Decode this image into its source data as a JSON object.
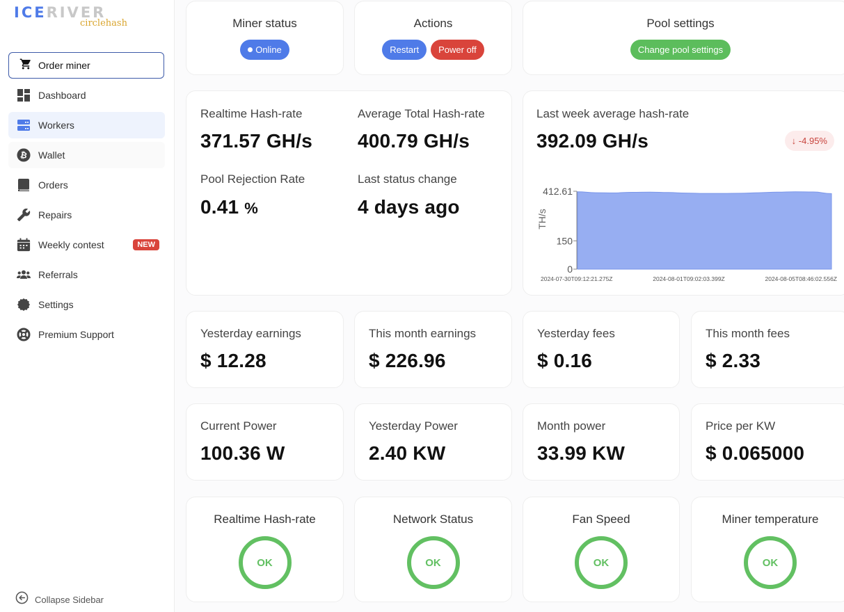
{
  "brand": {
    "name_part1": "ICE",
    "name_part2": "RIVER",
    "sub": "circlehash"
  },
  "sidebar": {
    "order_button": "Order miner",
    "items": [
      {
        "label": "Dashboard",
        "icon": "dashboard-icon"
      },
      {
        "label": "Workers",
        "icon": "server-icon",
        "active": true
      },
      {
        "label": "Wallet",
        "icon": "bitcoin-icon"
      },
      {
        "label": "Orders",
        "icon": "book-icon"
      },
      {
        "label": "Repairs",
        "icon": "wrench-icon"
      },
      {
        "label": "Weekly contest",
        "icon": "calendar-icon",
        "badge": "NEW"
      },
      {
        "label": "Referrals",
        "icon": "users-icon"
      },
      {
        "label": "Settings",
        "icon": "gear-icon"
      },
      {
        "label": "Premium Support",
        "icon": "lifebuoy-icon"
      }
    ],
    "collapse_label": "Collapse Sidebar"
  },
  "status_card": {
    "title": "Miner status",
    "status": "Online"
  },
  "actions_card": {
    "title": "Actions",
    "restart": "Restart",
    "power_off": "Power off"
  },
  "pool_card": {
    "title": "Pool settings",
    "button": "Change pool settings"
  },
  "hashrate_card": {
    "realtime_label": "Realtime Hash-rate",
    "realtime_value": "371.57 GH/s",
    "average_label": "Average Total Hash-rate",
    "average_value": "400.79 GH/s",
    "rejection_label": "Pool Rejection Rate",
    "rejection_value": "0.41",
    "rejection_unit": "%",
    "status_change_label": "Last status change",
    "status_change_value": "4 days ago"
  },
  "week_card": {
    "title": "Last week average hash-rate",
    "value": "392.09 GH/s",
    "trend": "-4.95%",
    "trend_icon": "arrow-down-icon"
  },
  "chart_data": {
    "type": "area",
    "title": "",
    "xlabel": "",
    "ylabel": "TH/s",
    "ylim": [
      0,
      412.61
    ],
    "y_ticks": [
      0,
      150,
      412.61
    ],
    "y_tick_labels": [
      "0",
      "150",
      "412.61"
    ],
    "x_tick_labels": [
      "2024-07-30T09:12:21.275Z",
      "2024-08-01T09:02:03.399Z",
      "2024-08-05T08:46:02.556Z"
    ],
    "grid": false,
    "color": "#97aef2",
    "series": [
      {
        "name": "hash-rate",
        "values": [
          410,
          405,
          404,
          407,
          408,
          406,
          403,
          401,
          401,
          402,
          405,
          408,
          410,
          409,
          400
        ]
      }
    ]
  },
  "earnings": [
    {
      "label": "Yesterday earnings",
      "value": "$ 12.28"
    },
    {
      "label": "This month earnings",
      "value": "$ 226.96"
    },
    {
      "label": "Yesterday fees",
      "value": "$ 0.16"
    },
    {
      "label": "This month fees",
      "value": "$ 2.33"
    }
  ],
  "power": [
    {
      "label": "Current Power",
      "value": "100.36 W"
    },
    {
      "label": "Yesterday Power",
      "value": "2.40 KW"
    },
    {
      "label": "Month power",
      "value": "33.99 KW"
    },
    {
      "label": "Price per KW",
      "value": "$ 0.065000"
    }
  ],
  "health": [
    {
      "label": "Realtime Hash-rate",
      "status": "OK"
    },
    {
      "label": "Network Status",
      "status": "OK"
    },
    {
      "label": "Fan Speed",
      "status": "OK"
    },
    {
      "label": "Miner temperature",
      "status": "OK"
    }
  ],
  "colors": {
    "accent": "#4f7be8",
    "danger": "#d9443b",
    "success": "#5cbd5c",
    "ok_ring": "#62c062"
  }
}
